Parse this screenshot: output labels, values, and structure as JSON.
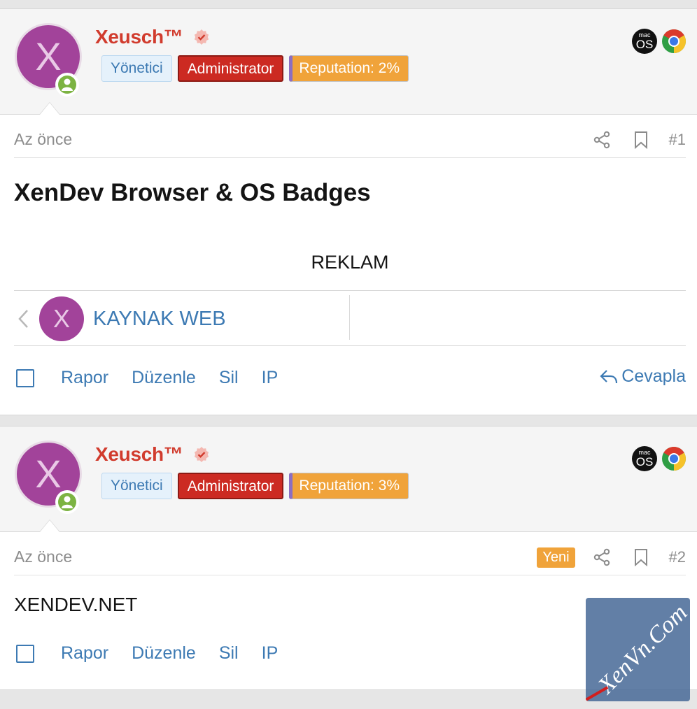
{
  "colors": {
    "accent": "#3d7ab3",
    "username": "#d13b2d",
    "admin": "#cc2a22",
    "reputation": "#f0a33a",
    "avatar": "#a2439a",
    "online": "#7cb342"
  },
  "posts": [
    {
      "user": {
        "avatar_letter": "X",
        "name": "Xeusch™",
        "badges": {
          "role": "Yönetici",
          "group": "Administrator",
          "reputation": "Reputation: 2%"
        },
        "os_icon": "macos-icon",
        "browser_icon": "chrome-icon",
        "os_top": "mac",
        "os_bottom": "OS"
      },
      "date": "Az önce",
      "number": "#1",
      "title": "XenDev Browser & OS Badges",
      "ad": "REKLAM",
      "share": {
        "avatar_letter": "X",
        "link": "KAYNAK WEB"
      },
      "actions": {
        "report": "Rapor",
        "edit": "Düzenle",
        "delete": "Sil",
        "ip": "IP",
        "reply": "Cevapla"
      }
    },
    {
      "user": {
        "avatar_letter": "X",
        "name": "Xeusch™",
        "badges": {
          "role": "Yönetici",
          "group": "Administrator",
          "reputation": "Reputation: 3%"
        },
        "os_icon": "macos-icon",
        "browser_icon": "chrome-icon",
        "os_top": "mac",
        "os_bottom": "OS"
      },
      "date": "Az önce",
      "new_label": "Yeni",
      "number": "#2",
      "body": "XENDEV.NET",
      "actions": {
        "report": "Rapor",
        "edit": "Düzenle",
        "delete": "Sil",
        "ip": "IP"
      }
    }
  ],
  "watermark": "XenVn.Com"
}
